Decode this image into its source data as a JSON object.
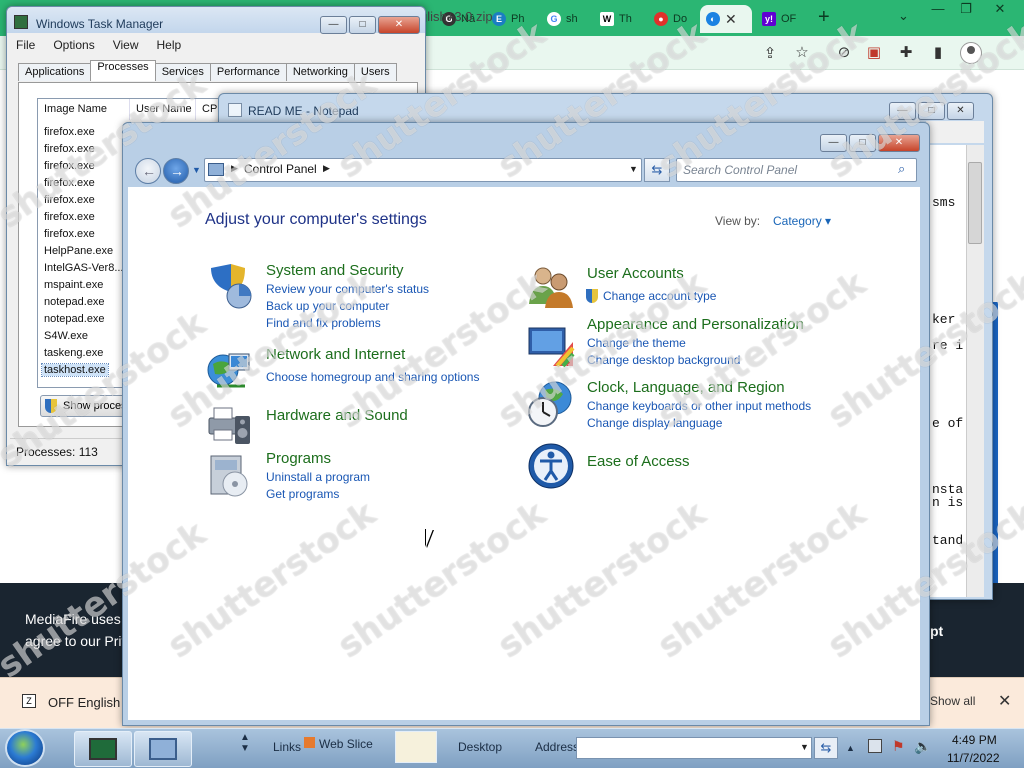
{
  "chrome": {
    "tabs": [
      {
        "label": "Nâ",
        "fav": "G"
      },
      {
        "label": "Ph",
        "fav": "E"
      },
      {
        "label": "sh",
        "fav": "G"
      },
      {
        "label": "Th",
        "fav": "W"
      },
      {
        "label": "Do",
        "fav": "●"
      },
      {
        "label": "",
        "fav": "◐"
      },
      {
        "label": "OF",
        "fav": "y!"
      }
    ],
    "url_text": "glish+3.0.zip",
    "cookie_text1": "MediaFire uses c",
    "cookie_text2": "agree to our Priv",
    "accept_label": "pt",
    "download_name": "OFF English 3",
    "show_all": "Show all",
    "new_tab_glyph": "+",
    "tab_menu_glyph": "⌄",
    "close_glyph": "✕"
  },
  "task_manager": {
    "title": "Windows Task Manager",
    "menu": [
      "File",
      "Options",
      "View",
      "Help"
    ],
    "tabs": [
      "Applications",
      "Processes",
      "Services",
      "Performance",
      "Networking",
      "Users"
    ],
    "active_tab": "Processes",
    "columns": [
      "Image Name",
      "User Name",
      "CPU"
    ],
    "processes": [
      "firefox.exe",
      "firefox.exe",
      "firefox.exe",
      "firefox.exe",
      "firefox.exe",
      "firefox.exe",
      "firefox.exe",
      "HelpPane.exe",
      "IntelGAS-Ver8...",
      "mspaint.exe",
      "notepad.exe",
      "notepad.exe",
      "S4W.exe",
      "taskeng.exe",
      "taskhost.exe"
    ],
    "selected_process": "taskhost.exe",
    "show_button": "Show proces",
    "status": "Processes: 113"
  },
  "notepad": {
    "title": "READ ME - Notepad",
    "lines": [
      "sms",
      "ker",
      "re i",
      "e of",
      "nsta",
      "n is",
      "tand"
    ]
  },
  "control_panel": {
    "breadcrumb": "Control Panel",
    "search_placeholder": "Search Control Panel",
    "heading": "Adjust your computer's settings",
    "view_by_label": "View by:",
    "view_by_value": "Category ▾",
    "categories_left": [
      {
        "title": "System and Security",
        "links": [
          "Review your computer's status",
          "Back up your computer",
          "Find and fix problems"
        ],
        "icon": "shield-security-icon"
      },
      {
        "title": "Network and Internet",
        "links": [
          "Choose homegroup and sharing options"
        ],
        "icon": "network-globe-icon"
      },
      {
        "title": "Hardware and Sound",
        "links": [],
        "icon": "printer-speaker-icon"
      },
      {
        "title": "Programs",
        "links": [
          "Uninstall a program",
          "Get programs"
        ],
        "icon": "programs-box-icon"
      }
    ],
    "categories_right": [
      {
        "title": "User Accounts",
        "links": [
          "Change account type"
        ],
        "icon": "users-icon"
      },
      {
        "title": "Appearance and Personalization",
        "links": [
          "Change the theme",
          "Change desktop background"
        ],
        "icon": "monitor-palette-icon"
      },
      {
        "title": "Clock, Language, and Region",
        "links": [
          "Change keyboards or other input methods",
          "Change display language"
        ],
        "icon": "clock-globe-icon"
      },
      {
        "title": "Ease of Access",
        "links": [],
        "icon": "ease-access-icon"
      }
    ]
  },
  "taskbar": {
    "links_label": "Links",
    "web_slice": "Web Slice",
    "desktop_label": "Desktop",
    "address_label": "Address",
    "time": "4:49 PM",
    "date": "11/7/2022"
  },
  "watermark": "shutterstock"
}
